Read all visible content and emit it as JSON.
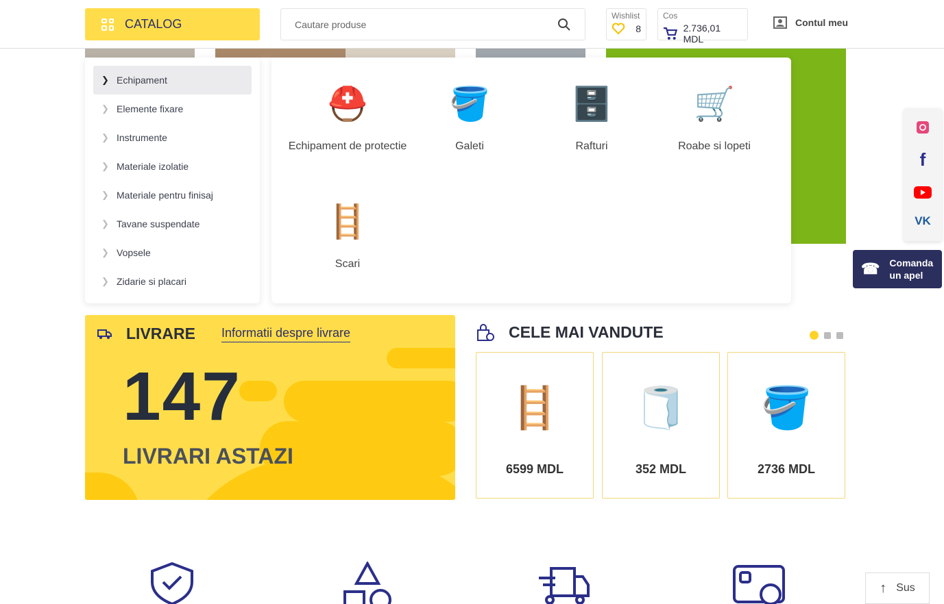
{
  "header": {
    "catalog_label": "CATALOG",
    "search_placeholder": "Cautare produse",
    "wishlist": {
      "label": "Wishlist",
      "count": "8"
    },
    "cart": {
      "label": "Cos",
      "total": "2.736,01 MDL"
    },
    "account_label": "Contul meu"
  },
  "menu": {
    "items": [
      {
        "label": "Echipament",
        "active": true
      },
      {
        "label": "Elemente fixare"
      },
      {
        "label": "Instrumente"
      },
      {
        "label": "Materiale izolatie"
      },
      {
        "label": "Materiale pentru finisaj"
      },
      {
        "label": "Tavane suspendate"
      },
      {
        "label": "Vopsele"
      },
      {
        "label": "Zidarie si placari"
      }
    ]
  },
  "submenu": {
    "items": [
      {
        "label": "Echipament de protectie",
        "icon": "hard-hat"
      },
      {
        "label": "Galeti",
        "icon": "buckets"
      },
      {
        "label": "Rafturi",
        "icon": "shelf"
      },
      {
        "label": "Roabe si lopeti",
        "icon": "wheelbarrow"
      },
      {
        "label": "Scari",
        "icon": "ladder"
      }
    ]
  },
  "delivery": {
    "title": "LIVRARE",
    "info_link": "Informatii despre livrare",
    "count": "147",
    "subtitle": "LIVRARI ASTAZI"
  },
  "bestsellers": {
    "title": "CELE MAI VANDUTE",
    "products": [
      {
        "price": "6599 MDL"
      },
      {
        "price": "352 MDL"
      },
      {
        "price": "2736 MDL"
      }
    ]
  },
  "call": {
    "label": "Comanda un apel"
  },
  "scroll_top": {
    "label": "Sus"
  },
  "colors": {
    "accent": "#ffdd4a",
    "navy": "#2b2f5e",
    "banner": "#7cb518"
  }
}
